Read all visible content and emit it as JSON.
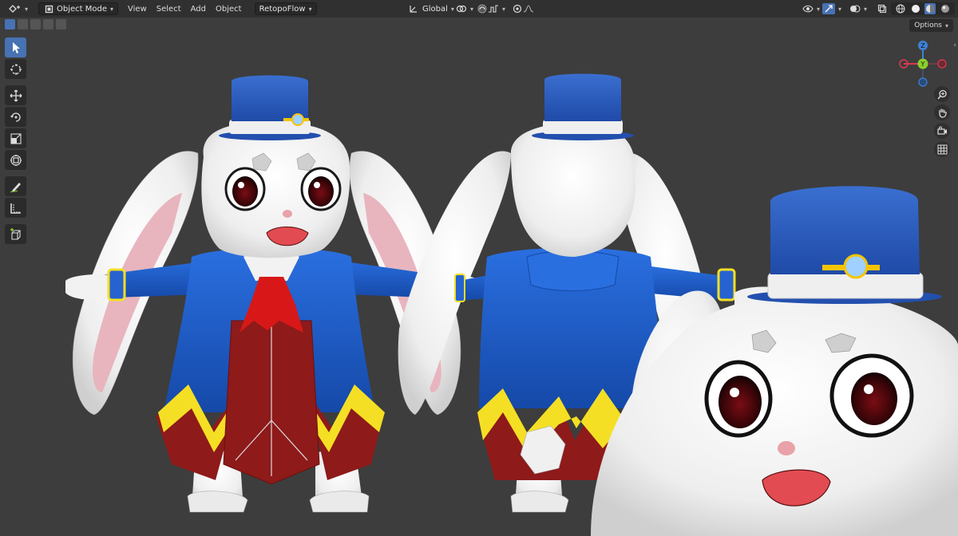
{
  "header": {
    "mode_label": "Object Mode",
    "menus": [
      "View",
      "Select",
      "Add",
      "Object"
    ],
    "addon_menu": "RetopoFlow",
    "transform_orientation": "Global"
  },
  "viewport": {
    "options_label": "Options"
  },
  "gizmo": {
    "axis_z": "Z",
    "axis_y": "Y"
  },
  "icons": {
    "editor_type": "editor-type-icon",
    "mode": "object-mode-icon",
    "orientation": "transform-orientation-icon",
    "pivot": "pivot-point-icon",
    "snap": "snap-magnet-icon",
    "proportional": "proportional-edit-icon",
    "visibility": "eye-icon",
    "gizmo": "gizmo-icon",
    "overlay": "overlay-icon",
    "xray": "xray-icon"
  },
  "tools": [
    "select-box",
    "cursor",
    "move",
    "rotate",
    "scale",
    "transform",
    "annotate",
    "measure",
    "add-cube"
  ],
  "colors": {
    "header_bg": "#303030",
    "viewport_bg": "#3d3d3d",
    "active_tool": "#4772b3",
    "axis_x": "#e0384f",
    "axis_y": "#8bcf2c",
    "axis_z": "#3d82d8",
    "coat_blue": "#1f63cc",
    "hat_blue": "#2b5ec4",
    "trim_yellow": "#f5df24",
    "vest_red": "#8e1a1a"
  }
}
